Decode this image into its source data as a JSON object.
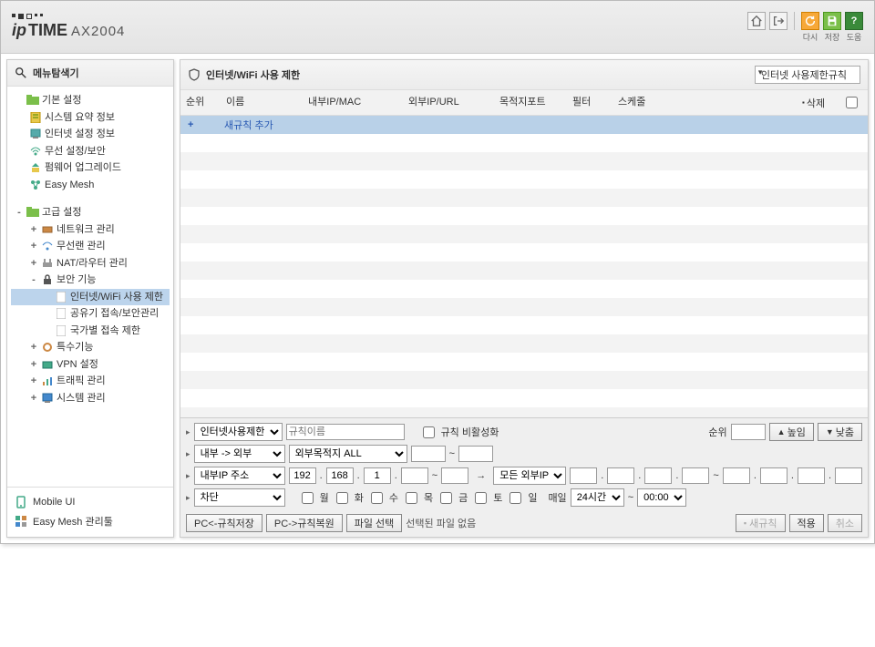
{
  "header": {
    "brand_ip": "ip",
    "brand_time": "TIME",
    "model": "AX2004",
    "icons": {
      "home": "⌂",
      "logout": "⎋",
      "refresh_label": "다시",
      "save_label": "저장",
      "help_label": "도움"
    }
  },
  "sidebar": {
    "title": "메뉴탐색기",
    "tree": {
      "basic": "기본 설정",
      "basic_items": [
        "시스템 요약 정보",
        "인터넷 설정 정보",
        "무선 설정/보안",
        "펌웨어 업그레이드",
        "Easy Mesh"
      ],
      "adv": "고급 설정",
      "adv_items": [
        "네트워크 관리",
        "무선랜 관리",
        "NAT/라우터 관리"
      ],
      "sec": "보안 기능",
      "sec_sub": [
        "인터넷/WiFi 사용 제한",
        "공유기 접속/보안관리",
        "국가별 접속 제한"
      ],
      "adv_tail": [
        "특수기능",
        "VPN 설정",
        "트래픽 관리",
        "시스템 관리"
      ]
    },
    "bottom": {
      "mobile": "Mobile UI",
      "easymesh": "Easy Mesh 관리툴"
    }
  },
  "main": {
    "title": "인터넷/WiFi 사용 제한",
    "select": "인터넷 사용제한규칙",
    "columns": [
      "순위",
      "이름",
      "내부IP/MAC",
      "외부IP/URL",
      "목적지포트",
      "필터",
      "스케줄",
      "삭제"
    ],
    "add_rule": "새규칙 추가",
    "form": {
      "type": [
        "인터넷사용제한"
      ],
      "rule_name_placeholder": "규칙이름",
      "disable_rule": "규칙 비활성화",
      "order_label": "순위",
      "up": "높임",
      "down": "낮춤",
      "direction": [
        "내부 -> 외부"
      ],
      "dest": [
        "외부목적지 ALL"
      ],
      "src_type": [
        "내부IP 주소"
      ],
      "ip": [
        "192",
        "168",
        "1",
        "",
        ""
      ],
      "tilde": "~",
      "ext": [
        "모든 외부IP"
      ],
      "action": [
        "차단"
      ],
      "days": [
        "월",
        "화",
        "수",
        "목",
        "금",
        "토",
        "일"
      ],
      "everyday": "매일",
      "allday": [
        "24시간"
      ],
      "time_sep": "~",
      "time2": [
        "00:00"
      ]
    },
    "footer": {
      "save_pc": "PC<-규칙저장",
      "restore_pc": "PC->규칙복원",
      "file_select": "파일 선택",
      "no_file": "선택된 파일 없음",
      "new_rule": "새규칙",
      "apply": "적용",
      "cancel": "취소",
      "del_icon": "▪"
    },
    "arrow": "→"
  }
}
